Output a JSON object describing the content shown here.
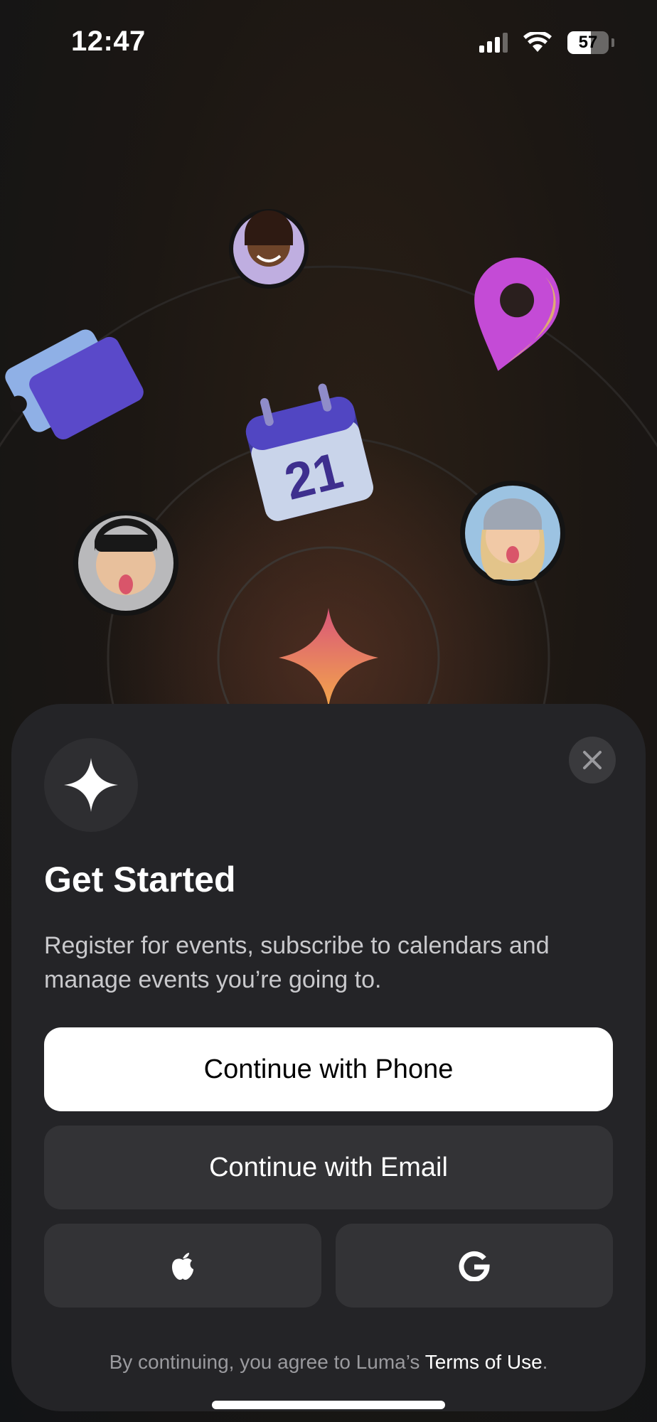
{
  "status_bar": {
    "time": "12:47",
    "battery": "57",
    "icons": [
      "cellular-signal-icon",
      "wifi-icon",
      "battery-icon"
    ]
  },
  "hero": {
    "calendar_day": "21",
    "icons": [
      "ticket-icon",
      "calendar-icon",
      "location-pin-icon",
      "sparkle-icon"
    ],
    "colors": {
      "ring": "#3b3531",
      "sparkle_top": "#d9567a",
      "sparkle_bottom": "#f3a64a",
      "pin": "#c44bd6"
    }
  },
  "sheet": {
    "title": "Get Started",
    "subtitle": "Register for events, subscribe to calendars and manage events you’re going to.",
    "phone_button": "Continue with Phone",
    "email_button": "Continue with Email",
    "apple_button_icon": "apple-icon",
    "google_button_icon": "google-icon",
    "terms_prefix": "By continuing, you agree to Luma’s ",
    "terms_link": "Terms of Use",
    "terms_suffix": ".",
    "colors": {
      "sheet_bg": "#242427",
      "secondary_button": "#333336",
      "primary_button": "#ffffff"
    }
  }
}
